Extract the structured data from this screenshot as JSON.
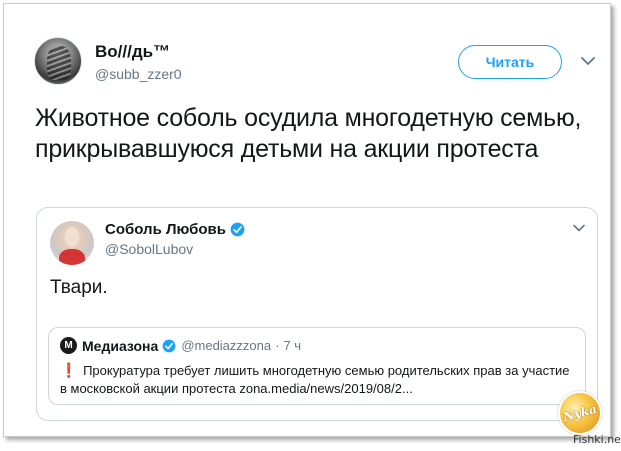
{
  "tweet": {
    "display_name": "Во///дь™",
    "handle": "@subb_zzer0",
    "follow_label": "Читать",
    "text": "Животное соболь осудила многодетную семью, прикрывавшуюся детьми на акции протеста",
    "menu_icon": "chevron-down-icon"
  },
  "quote": {
    "display_name": "Соболь Любовь",
    "handle": "@SobolLubov",
    "verified_icon": "verified-badge-icon",
    "text": "Твари.",
    "menu_icon": "chevron-down-icon",
    "nested": {
      "logo_letter": "M",
      "display_name": "Медиазона",
      "handle": "@mediazzzona",
      "dot": "·",
      "time": "7 ч",
      "emoji": "❗",
      "text": "Прокуратура требует лишить многодетную семью родительских прав за участие в московской акции протеста zona.media/news/2019/08/2..."
    }
  },
  "watermark": {
    "badge": "Nyka",
    "site": "Fishki.net"
  },
  "colors": {
    "accent": "#1da1f2",
    "text": "#14171a",
    "secondary": "#657786",
    "border": "#ccd6dd",
    "alert": "#dd2e44"
  }
}
